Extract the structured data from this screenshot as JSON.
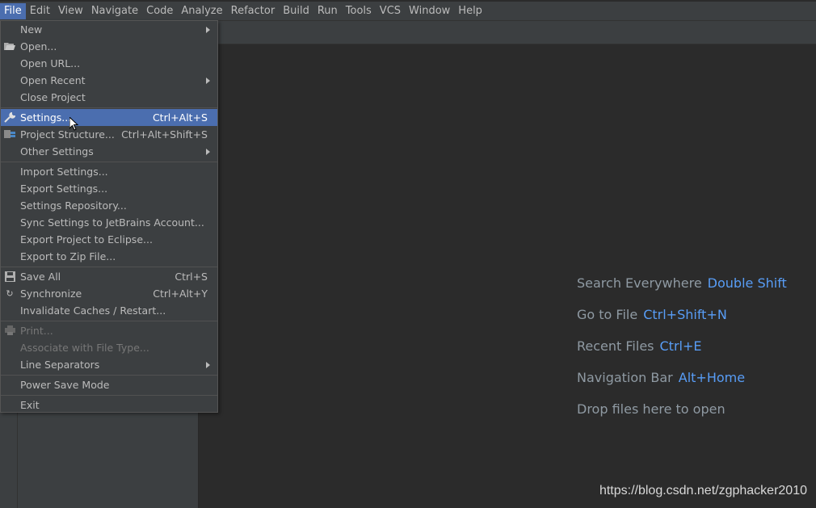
{
  "menubar": {
    "items": [
      "File",
      "Edit",
      "View",
      "Navigate",
      "Code",
      "Analyze",
      "Refactor",
      "Build",
      "Run",
      "Tools",
      "VCS",
      "Window",
      "Help"
    ]
  },
  "file_menu": {
    "new": "New",
    "open": "Open...",
    "open_url": "Open URL...",
    "open_recent": "Open Recent",
    "close_project": "Close Project",
    "settings": "Settings...",
    "settings_sc": "Ctrl+Alt+S",
    "project_structure": "Project Structure...",
    "project_structure_sc": "Ctrl+Alt+Shift+S",
    "other_settings": "Other Settings",
    "import_settings": "Import Settings...",
    "export_settings": "Export Settings...",
    "settings_repository": "Settings Repository...",
    "sync_settings": "Sync Settings to JetBrains Account...",
    "export_eclipse": "Export Project to Eclipse...",
    "export_zip": "Export to Zip File...",
    "save_all": "Save All",
    "save_all_sc": "Ctrl+S",
    "synchronize": "Synchronize",
    "synchronize_sc": "Ctrl+Alt+Y",
    "invalidate": "Invalidate Caches / Restart...",
    "print": "Print...",
    "associate": "Associate with File Type...",
    "line_separators": "Line Separators",
    "power_save": "Power Save Mode",
    "exit": "Exit"
  },
  "editor": {
    "search_label": "Search Everywhere",
    "search_key": "Double Shift",
    "goto_label": "Go to File",
    "goto_key": "Ctrl+Shift+N",
    "recent_label": "Recent Files",
    "recent_key": "Ctrl+E",
    "nav_label": "Navigation Bar",
    "nav_key": "Alt+Home",
    "drop_label": "Drop files here to open"
  },
  "watermark": "https://blog.csdn.net/zgphacker2010",
  "colors": {
    "accent": "#4b6eaf",
    "key": "#589df6",
    "background": "#2b2b2b",
    "panel": "#3c3f41"
  }
}
